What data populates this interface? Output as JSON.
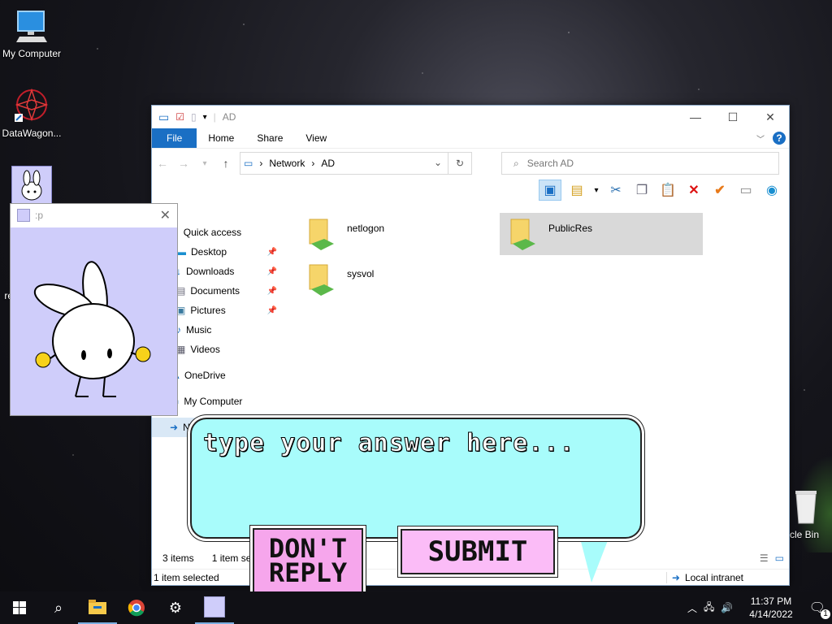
{
  "desktop": {
    "icons": [
      {
        "label": "My Computer"
      },
      {
        "label": "DataWagon..."
      },
      {
        "label": "re"
      },
      {
        "label": "cle Bin"
      }
    ]
  },
  "explorer": {
    "title": "AD",
    "tabs": [
      "File",
      "Home",
      "Share",
      "View"
    ],
    "address": {
      "parts": [
        "Network",
        "AD"
      ]
    },
    "search_placeholder": "Search AD",
    "nav": [
      {
        "label": "Quick access",
        "pinned": false
      },
      {
        "label": "Desktop",
        "pinned": true
      },
      {
        "label": "Downloads",
        "pinned": true
      },
      {
        "label": "Documents",
        "pinned": true
      },
      {
        "label": "Pictures",
        "pinned": true
      },
      {
        "label": "Music",
        "pinned": false
      },
      {
        "label": "Videos",
        "pinned": false
      },
      {
        "label": "OneDrive",
        "pinned": false
      },
      {
        "label": "My Computer",
        "pinned": false
      },
      {
        "label": "N",
        "pinned": false
      }
    ],
    "folders": [
      {
        "name": "netlogon",
        "selected": false
      },
      {
        "name": "PublicRes",
        "selected": true
      },
      {
        "name": "sysvol",
        "selected": false
      }
    ],
    "status": {
      "count": "3 items",
      "selected_short": "1 item sel",
      "selected": "1 item selected",
      "zone": "Local intranet"
    }
  },
  "popup": {
    "title": ":p"
  },
  "prompt": {
    "placeholder": "type your answer here...",
    "dont_reply": "DON'T REPLY",
    "submit": "SUBMIT"
  },
  "taskbar": {
    "time": "11:37 PM",
    "date": "4/14/2022",
    "notifications": "1"
  },
  "colors": {
    "accent": "#1a6fc4",
    "bubble": "#a8fcfb",
    "button_pink": "#fbbcf7",
    "bunny_bg": "#cfcdfa"
  }
}
